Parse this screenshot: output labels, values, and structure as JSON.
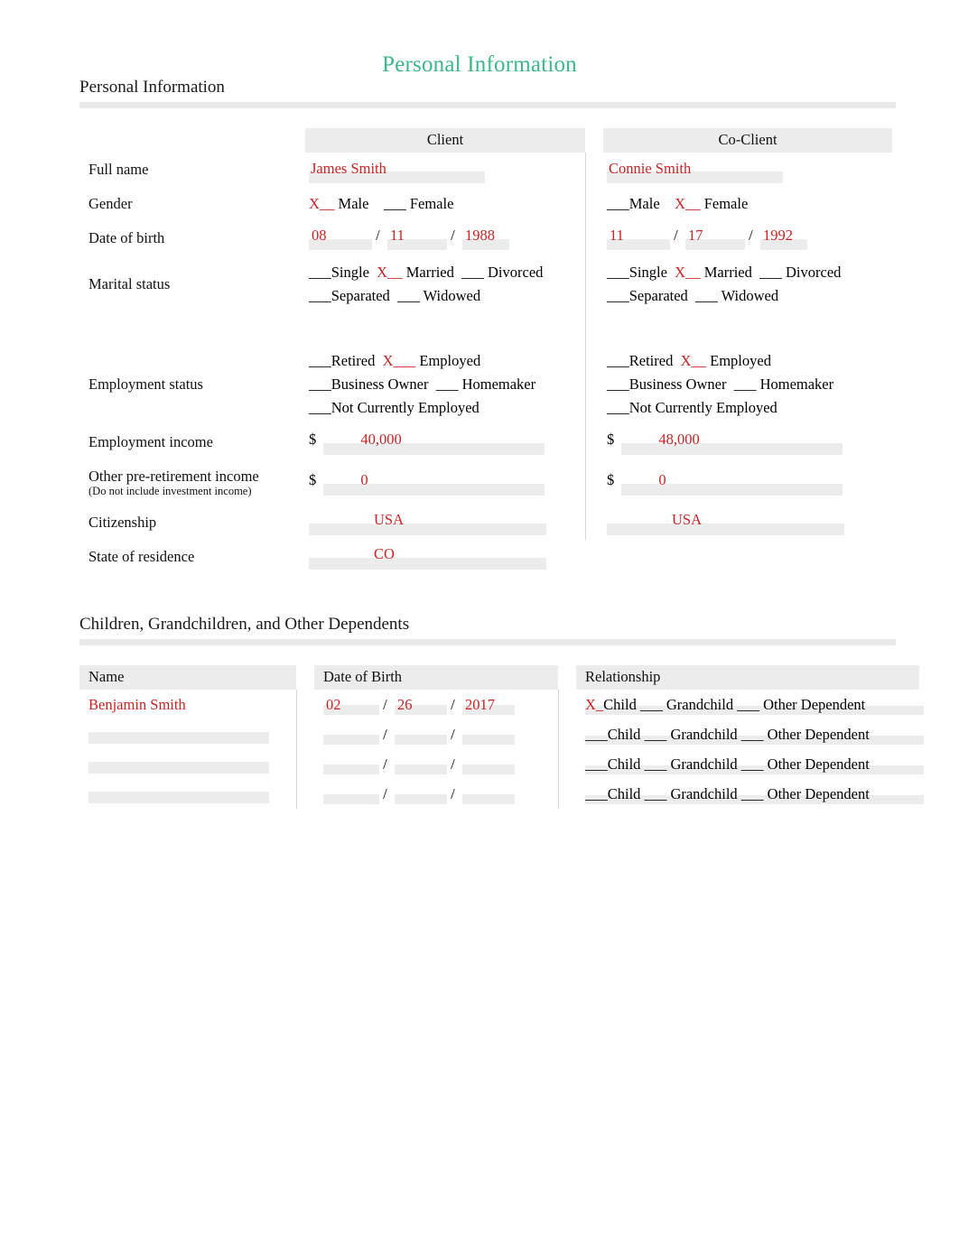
{
  "document": {
    "title": "Personal Information"
  },
  "sections": {
    "personal": {
      "heading": "Personal Information",
      "columns": [
        "Client",
        "Co-Client"
      ],
      "rows": {
        "full_name": {
          "label": "Full name",
          "client": "James Smith",
          "coclient": "Connie Smith"
        },
        "gender": {
          "label": "Gender",
          "client": {
            "male_mark": "X__",
            "male": "Male",
            "female_mark": "___",
            "female": "Female"
          },
          "coclient": {
            "male_mark": "___",
            "male": "Male",
            "female_mark": "X__",
            "female": "Female"
          }
        },
        "dob": {
          "label": "Date of birth",
          "client": {
            "month": "08",
            "day": "11",
            "year": "1988"
          },
          "coclient": {
            "month": "11",
            "day": "17",
            "year": "1992"
          }
        },
        "marital": {
          "label": "Marital status",
          "options_line1": [
            "Single",
            "Married",
            "Divorced"
          ],
          "options_line2": [
            "Separated",
            "Widowed"
          ],
          "client_marks": {
            "single": "___",
            "married": "X__",
            "divorced": "___",
            "separated": "___",
            "widowed": "___"
          },
          "coclient_marks": {
            "single": "___",
            "married": "X__",
            "divorced": "___",
            "separated": "___",
            "widowed": "___"
          }
        },
        "employment": {
          "label": "Employment status",
          "options_line1": [
            "Retired",
            "Employed"
          ],
          "options_line2": [
            "Business Owner",
            "Homemaker"
          ],
          "options_line3": [
            "Not Currently Employed"
          ],
          "client_marks": {
            "retired": "___",
            "employed": "X___",
            "business_owner": "___",
            "homemaker": "___",
            "not_employed": "___"
          },
          "coclient_marks": {
            "retired": "___",
            "employed": "X__",
            "business_owner": "___",
            "homemaker": "___",
            "not_employed": "___"
          }
        },
        "employment_income": {
          "label": "Employment income",
          "currency": "$",
          "client": "40,000",
          "coclient": "48,000"
        },
        "other_income": {
          "label": "Other pre-retirement income",
          "sublabel": "(Do not include investment income)",
          "currency": "$",
          "client": "0",
          "coclient": "0"
        },
        "citizenship": {
          "label": "Citizenship",
          "client": "USA",
          "coclient": "USA"
        },
        "state": {
          "label": "State of residence",
          "client": "CO",
          "coclient": ""
        }
      }
    },
    "dependents": {
      "heading": "Children, Grandchildren, and Other Dependents",
      "columns": [
        "Name",
        "Date of Birth",
        "Relationship"
      ],
      "relationship_options": [
        "Child",
        "Grandchild",
        "Other Dependent"
      ],
      "rows": [
        {
          "name": "Benjamin Smith",
          "dob": {
            "month": "02",
            "day": "26",
            "year": "2017"
          },
          "marks": {
            "child": "X_",
            "grandchild": "___",
            "other": "___"
          }
        },
        {
          "name": "",
          "dob": {
            "month": "",
            "day": "",
            "year": ""
          },
          "marks": {
            "child": "___",
            "grandchild": "___",
            "other": "___"
          }
        },
        {
          "name": "",
          "dob": {
            "month": "",
            "day": "",
            "year": ""
          },
          "marks": {
            "child": "___",
            "grandchild": "___",
            "other": "___"
          }
        },
        {
          "name": "",
          "dob": {
            "month": "",
            "day": "",
            "year": ""
          },
          "marks": {
            "child": "___",
            "grandchild": "___",
            "other": "___"
          }
        }
      ]
    }
  },
  "colors": {
    "title": "#3cb887",
    "value": "#cc2222",
    "field": "#ececec"
  }
}
